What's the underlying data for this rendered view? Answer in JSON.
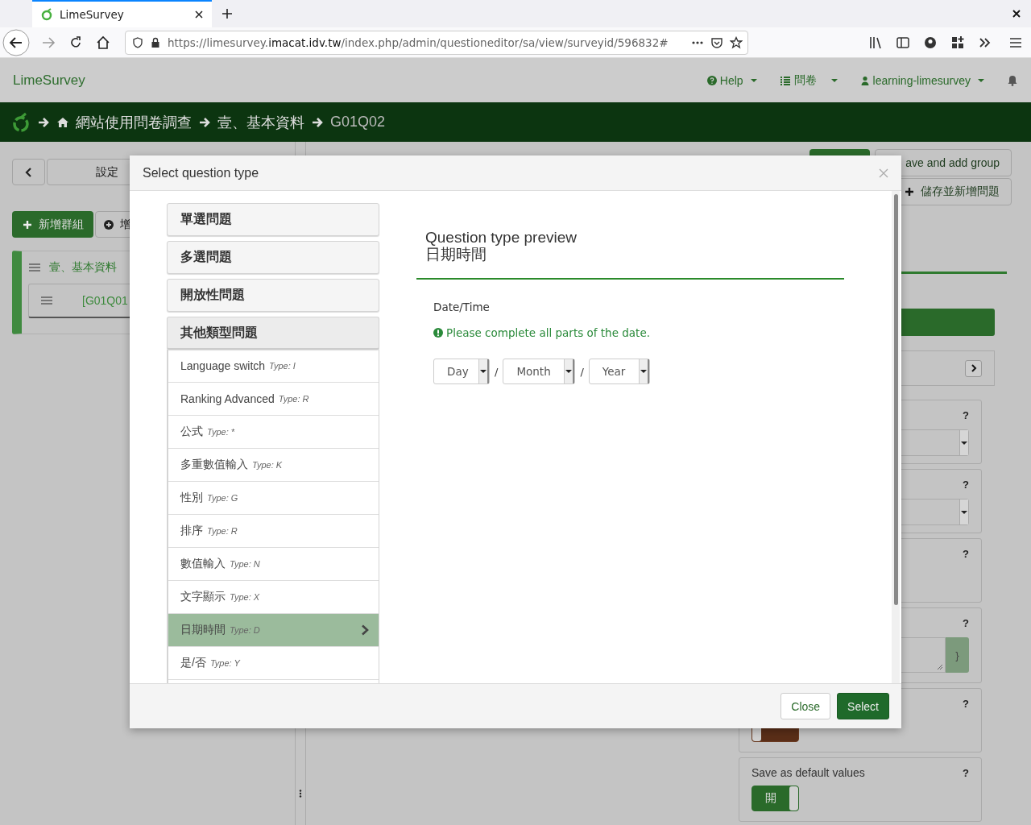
{
  "browser": {
    "tab_title": "LimeSurvey",
    "url": {
      "scheme": "https://limesurvey.",
      "domain": "imacat.idv.tw",
      "path": "/index.php/admin/questioneditor/sa/view/surveyid/596832#"
    }
  },
  "app_bar": {
    "brand": "LimeSurvey",
    "help": "Help",
    "surveys": "問卷",
    "user": "learning-limesurvey"
  },
  "breadcrumb": [
    "網站使用問卷調查",
    "壹、基本資料",
    "G01Q02"
  ],
  "sidebar": {
    "settings": "設定",
    "add_group": "新增群組",
    "add_question": "增",
    "groups": [
      {
        "title": "壹、基本資料",
        "children": [
          {
            "title": "[G01Q01"
          }
        ]
      }
    ]
  },
  "right_panel": {
    "buttons": [
      "ave and add group",
      "儲存並新增問題"
    ],
    "cards": [
      {
        "kind": "select",
        "help": "?"
      },
      {
        "kind": "select",
        "help": "?"
      },
      {
        "kind": "blank",
        "help": "?"
      },
      {
        "kind": "textarea",
        "help": "?",
        "addon": "}"
      },
      {
        "kind": "toggle",
        "help": "?",
        "on": false
      },
      {
        "kind": "toggle",
        "help": "?",
        "title": "Save as default values",
        "on": true,
        "label": "開"
      }
    ]
  },
  "modal": {
    "title": "Select question type",
    "categories": [
      {
        "label": "單選問題",
        "expanded": false
      },
      {
        "label": "多選問題",
        "expanded": false
      },
      {
        "label": "開放性問題",
        "expanded": false
      },
      {
        "label": "其他類型問題",
        "expanded": true,
        "items": [
          {
            "label": "Language switch",
            "type": "Type: I",
            "selected": false
          },
          {
            "label": "Ranking Advanced",
            "type": "Type: R",
            "selected": false
          },
          {
            "label": "公式",
            "type": "Type: *",
            "selected": false
          },
          {
            "label": "多重數值輸入",
            "type": "Type: K",
            "selected": false
          },
          {
            "label": "性別",
            "type": "Type: G",
            "selected": false
          },
          {
            "label": "排序",
            "type": "Type: R",
            "selected": false
          },
          {
            "label": "數值輸入",
            "type": "Type: N",
            "selected": false
          },
          {
            "label": "文字顯示",
            "type": "Type: X",
            "selected": false
          },
          {
            "label": "日期時間",
            "type": "Type: D",
            "selected": true
          },
          {
            "label": "是/否",
            "type": "Type: Y",
            "selected": false
          }
        ]
      }
    ],
    "preview": {
      "heading": "Question type preview",
      "name": "日期時間",
      "question": "Date/Time",
      "warning": "Please complete all parts of the date.",
      "date_parts": [
        {
          "value": "Day"
        },
        {
          "separator": "/",
          "value": "Month"
        },
        {
          "separator": "/",
          "value": "Year"
        }
      ]
    },
    "buttons": [
      {
        "kind": "default",
        "label": "Close"
      },
      {
        "kind": "primary",
        "label": "Select"
      }
    ]
  }
}
